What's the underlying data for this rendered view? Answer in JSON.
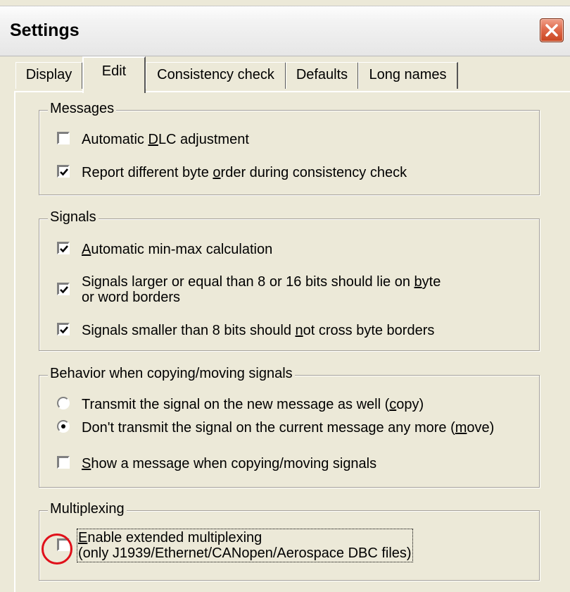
{
  "window": {
    "title": "Settings",
    "close_icon": "close-icon"
  },
  "tabs": [
    {
      "label": "Display",
      "active": false
    },
    {
      "label": "Edit",
      "active": true
    },
    {
      "label": "Consistency check",
      "active": false
    },
    {
      "label": "Defaults",
      "active": false
    },
    {
      "label": "Long names",
      "active": false
    }
  ],
  "messages": {
    "legend": "Messages",
    "auto_dlc": {
      "pre": "Automatic ",
      "key": "D",
      "post": "LC adjustment",
      "checked": false
    },
    "byte_order": {
      "pre": "Report different byte ",
      "key": "o",
      "post": "rder during consistency check",
      "checked": true
    }
  },
  "signals": {
    "legend": "Signals",
    "minmax": {
      "pre": "",
      "key": "A",
      "post": "utomatic min-max calculation",
      "checked": true
    },
    "borders": {
      "line1_pre": "Signals larger or equal than 8 or 16 bits should lie on ",
      "line1_key": "b",
      "line1_post": "yte",
      "line2": "or word borders",
      "checked": true
    },
    "small": {
      "pre": "Signals smaller than 8 bits should ",
      "key": "n",
      "post": "ot cross byte borders",
      "checked": true
    }
  },
  "behavior": {
    "legend": "Behavior when copying/moving signals",
    "copy": {
      "pre": "Transmit the signal on the new message as well (",
      "key": "c",
      "post": "opy)",
      "selected": false
    },
    "move": {
      "pre": "Don't transmit the signal on the current message any more (",
      "key": "m",
      "post": "ove)",
      "selected": true
    },
    "show_msg": {
      "pre": "",
      "key": "S",
      "post": "how a message when copying/moving signals",
      "checked": false
    }
  },
  "multiplexing": {
    "legend": "Multiplexing",
    "extended": {
      "line1_key": "E",
      "line1_post": "nable extended multiplexing",
      "line2": "(only J1939/Ethernet/CANopen/Aerospace DBC files)",
      "checked": false
    }
  },
  "colors": {
    "accent_circle": "#e0101a",
    "close_button": "#d9532f"
  }
}
